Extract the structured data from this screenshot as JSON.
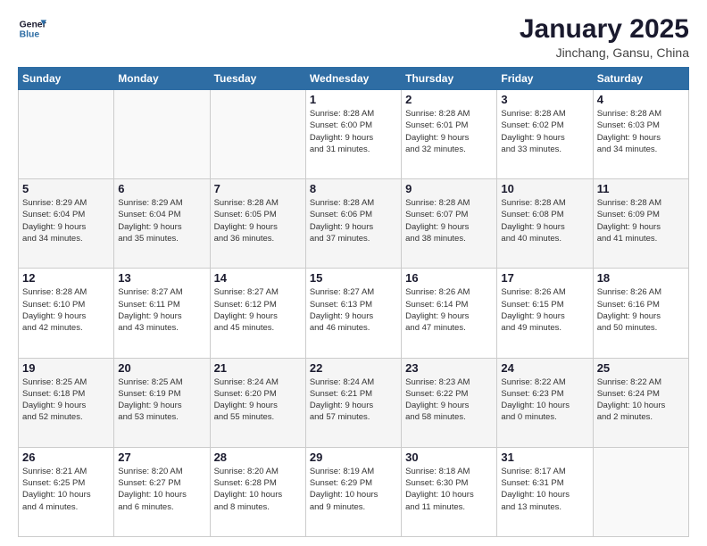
{
  "logo": {
    "line1": "General",
    "line2": "Blue"
  },
  "title": "January 2025",
  "location": "Jinchang, Gansu, China",
  "weekdays": [
    "Sunday",
    "Monday",
    "Tuesday",
    "Wednesday",
    "Thursday",
    "Friday",
    "Saturday"
  ],
  "weeks": [
    [
      {
        "day": "",
        "info": ""
      },
      {
        "day": "",
        "info": ""
      },
      {
        "day": "",
        "info": ""
      },
      {
        "day": "1",
        "info": "Sunrise: 8:28 AM\nSunset: 6:00 PM\nDaylight: 9 hours\nand 31 minutes."
      },
      {
        "day": "2",
        "info": "Sunrise: 8:28 AM\nSunset: 6:01 PM\nDaylight: 9 hours\nand 32 minutes."
      },
      {
        "day": "3",
        "info": "Sunrise: 8:28 AM\nSunset: 6:02 PM\nDaylight: 9 hours\nand 33 minutes."
      },
      {
        "day": "4",
        "info": "Sunrise: 8:28 AM\nSunset: 6:03 PM\nDaylight: 9 hours\nand 34 minutes."
      }
    ],
    [
      {
        "day": "5",
        "info": "Sunrise: 8:29 AM\nSunset: 6:04 PM\nDaylight: 9 hours\nand 34 minutes."
      },
      {
        "day": "6",
        "info": "Sunrise: 8:29 AM\nSunset: 6:04 PM\nDaylight: 9 hours\nand 35 minutes."
      },
      {
        "day": "7",
        "info": "Sunrise: 8:28 AM\nSunset: 6:05 PM\nDaylight: 9 hours\nand 36 minutes."
      },
      {
        "day": "8",
        "info": "Sunrise: 8:28 AM\nSunset: 6:06 PM\nDaylight: 9 hours\nand 37 minutes."
      },
      {
        "day": "9",
        "info": "Sunrise: 8:28 AM\nSunset: 6:07 PM\nDaylight: 9 hours\nand 38 minutes."
      },
      {
        "day": "10",
        "info": "Sunrise: 8:28 AM\nSunset: 6:08 PM\nDaylight: 9 hours\nand 40 minutes."
      },
      {
        "day": "11",
        "info": "Sunrise: 8:28 AM\nSunset: 6:09 PM\nDaylight: 9 hours\nand 41 minutes."
      }
    ],
    [
      {
        "day": "12",
        "info": "Sunrise: 8:28 AM\nSunset: 6:10 PM\nDaylight: 9 hours\nand 42 minutes."
      },
      {
        "day": "13",
        "info": "Sunrise: 8:27 AM\nSunset: 6:11 PM\nDaylight: 9 hours\nand 43 minutes."
      },
      {
        "day": "14",
        "info": "Sunrise: 8:27 AM\nSunset: 6:12 PM\nDaylight: 9 hours\nand 45 minutes."
      },
      {
        "day": "15",
        "info": "Sunrise: 8:27 AM\nSunset: 6:13 PM\nDaylight: 9 hours\nand 46 minutes."
      },
      {
        "day": "16",
        "info": "Sunrise: 8:26 AM\nSunset: 6:14 PM\nDaylight: 9 hours\nand 47 minutes."
      },
      {
        "day": "17",
        "info": "Sunrise: 8:26 AM\nSunset: 6:15 PM\nDaylight: 9 hours\nand 49 minutes."
      },
      {
        "day": "18",
        "info": "Sunrise: 8:26 AM\nSunset: 6:16 PM\nDaylight: 9 hours\nand 50 minutes."
      }
    ],
    [
      {
        "day": "19",
        "info": "Sunrise: 8:25 AM\nSunset: 6:18 PM\nDaylight: 9 hours\nand 52 minutes."
      },
      {
        "day": "20",
        "info": "Sunrise: 8:25 AM\nSunset: 6:19 PM\nDaylight: 9 hours\nand 53 minutes."
      },
      {
        "day": "21",
        "info": "Sunrise: 8:24 AM\nSunset: 6:20 PM\nDaylight: 9 hours\nand 55 minutes."
      },
      {
        "day": "22",
        "info": "Sunrise: 8:24 AM\nSunset: 6:21 PM\nDaylight: 9 hours\nand 57 minutes."
      },
      {
        "day": "23",
        "info": "Sunrise: 8:23 AM\nSunset: 6:22 PM\nDaylight: 9 hours\nand 58 minutes."
      },
      {
        "day": "24",
        "info": "Sunrise: 8:22 AM\nSunset: 6:23 PM\nDaylight: 10 hours\nand 0 minutes."
      },
      {
        "day": "25",
        "info": "Sunrise: 8:22 AM\nSunset: 6:24 PM\nDaylight: 10 hours\nand 2 minutes."
      }
    ],
    [
      {
        "day": "26",
        "info": "Sunrise: 8:21 AM\nSunset: 6:25 PM\nDaylight: 10 hours\nand 4 minutes."
      },
      {
        "day": "27",
        "info": "Sunrise: 8:20 AM\nSunset: 6:27 PM\nDaylight: 10 hours\nand 6 minutes."
      },
      {
        "day": "28",
        "info": "Sunrise: 8:20 AM\nSunset: 6:28 PM\nDaylight: 10 hours\nand 8 minutes."
      },
      {
        "day": "29",
        "info": "Sunrise: 8:19 AM\nSunset: 6:29 PM\nDaylight: 10 hours\nand 9 minutes."
      },
      {
        "day": "30",
        "info": "Sunrise: 8:18 AM\nSunset: 6:30 PM\nDaylight: 10 hours\nand 11 minutes."
      },
      {
        "day": "31",
        "info": "Sunrise: 8:17 AM\nSunset: 6:31 PM\nDaylight: 10 hours\nand 13 minutes."
      },
      {
        "day": "",
        "info": ""
      }
    ]
  ]
}
